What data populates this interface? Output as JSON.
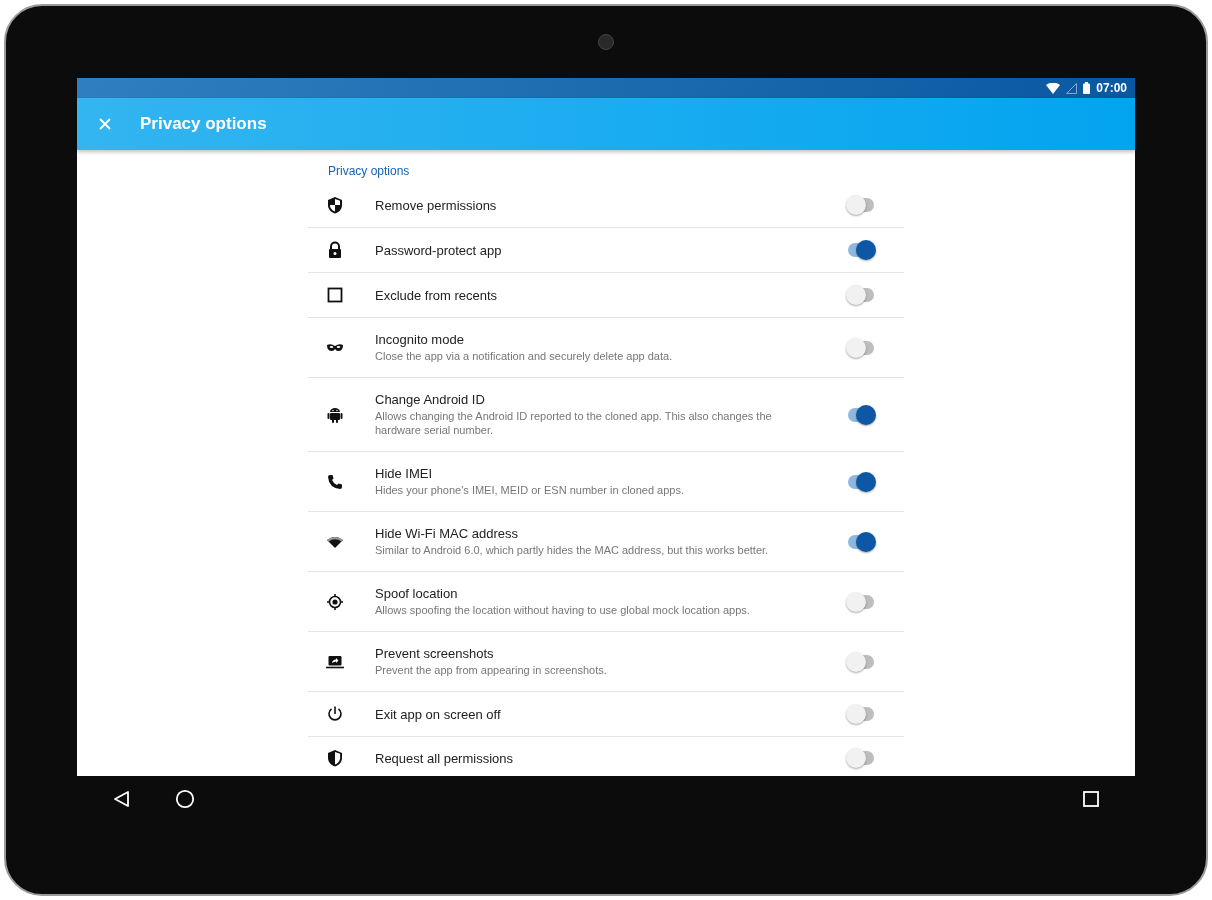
{
  "status_bar": {
    "time": "07:00"
  },
  "app_bar": {
    "title": "Privacy options"
  },
  "section": {
    "title": "Privacy options"
  },
  "items": [
    {
      "title": "Remove permissions",
      "on": false
    },
    {
      "title": "Password-protect app",
      "on": true
    },
    {
      "title": "Exclude from recents",
      "on": false
    },
    {
      "title": "Incognito mode",
      "subtitle": "Close the app via a notification and securely delete app data.",
      "on": false
    },
    {
      "title": "Change Android ID",
      "subtitle": "Allows changing the Android ID reported to the cloned app. This also changes the hardware serial number.",
      "on": true
    },
    {
      "title": "Hide IMEI",
      "subtitle": "Hides your phone's IMEI, MEID or ESN number in cloned apps.",
      "on": true
    },
    {
      "title": "Hide Wi-Fi MAC address",
      "subtitle": "Similar to Android 6.0, which partly hides the MAC address, but this works better.",
      "on": true
    },
    {
      "title": "Spoof location",
      "subtitle": "Allows spoofing the location without having to use global mock location apps.",
      "on": false
    },
    {
      "title": "Prevent screenshots",
      "subtitle": "Prevent the app from appearing in screenshots.",
      "on": false
    },
    {
      "title": "Exit app on screen off",
      "on": false
    },
    {
      "title": "Request all permissions",
      "on": false
    }
  ]
}
